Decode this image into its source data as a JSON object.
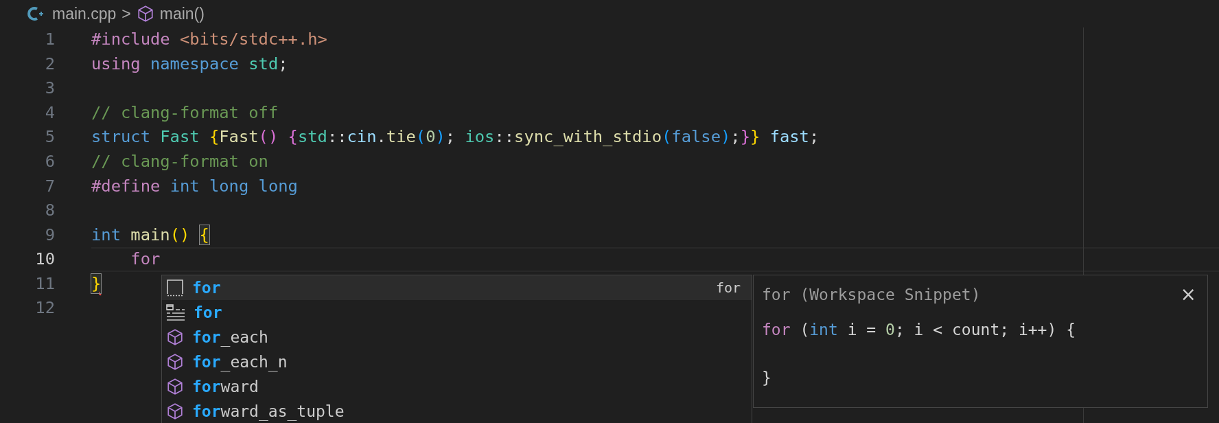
{
  "breadcrumb": {
    "file": "main.cpp",
    "separator": ">",
    "symbol": "main()"
  },
  "editor": {
    "lines": [
      {
        "number": "1",
        "active": false,
        "tokens": [
          {
            "text": "#include ",
            "kind": "keyword"
          },
          {
            "text": "<bits/stdc++.h>",
            "kind": "string"
          }
        ]
      },
      {
        "number": "2",
        "active": false,
        "tokens": [
          {
            "text": "using ",
            "kind": "keyword"
          },
          {
            "text": "namespace ",
            "kind": "storage"
          },
          {
            "text": "std",
            "kind": "type"
          },
          {
            "text": ";",
            "kind": "plain"
          }
        ]
      },
      {
        "number": "3",
        "active": false
      },
      {
        "number": "4",
        "active": false,
        "tokens": [
          {
            "text": "// clang-format off",
            "kind": "comment"
          }
        ]
      },
      {
        "number": "5",
        "active": false,
        "tokens": [
          {
            "text": "struct ",
            "kind": "storage"
          },
          {
            "text": "Fast ",
            "kind": "type"
          },
          {
            "text": "{",
            "kind": "bracket1"
          },
          {
            "text": "Fast",
            "kind": "func"
          },
          {
            "text": "() ",
            "kind": "bracket2"
          },
          {
            "text": "{",
            "kind": "bracket2"
          },
          {
            "text": "std",
            "kind": "type"
          },
          {
            "text": "::",
            "kind": "plain"
          },
          {
            "text": "cin",
            "kind": "variable"
          },
          {
            "text": ".",
            "kind": "plain"
          },
          {
            "text": "tie",
            "kind": "func"
          },
          {
            "text": "(",
            "kind": "bracket3"
          },
          {
            "text": "0",
            "kind": "number"
          },
          {
            "text": ")",
            "kind": "bracket3"
          },
          {
            "text": "; ",
            "kind": "plain"
          },
          {
            "text": "ios",
            "kind": "type"
          },
          {
            "text": "::",
            "kind": "plain"
          },
          {
            "text": "sync_with_stdio",
            "kind": "func"
          },
          {
            "text": "(",
            "kind": "bracket3"
          },
          {
            "text": "false",
            "kind": "storage"
          },
          {
            "text": ")",
            "kind": "bracket3"
          },
          {
            "text": ";",
            "kind": "plain"
          },
          {
            "text": "}",
            "kind": "bracket2"
          },
          {
            "text": "} ",
            "kind": "bracket1"
          },
          {
            "text": "fast",
            "kind": "variable"
          },
          {
            "text": ";",
            "kind": "plain"
          }
        ]
      },
      {
        "number": "6",
        "active": false,
        "tokens": [
          {
            "text": "// clang-format on",
            "kind": "comment"
          }
        ]
      },
      {
        "number": "7",
        "active": false,
        "tokens": [
          {
            "text": "#define ",
            "kind": "keyword"
          },
          {
            "text": "int ",
            "kind": "storage"
          },
          {
            "text": "long long",
            "kind": "storage"
          }
        ]
      },
      {
        "number": "8",
        "active": false
      },
      {
        "number": "9",
        "active": false,
        "tokens": [
          {
            "text": "int ",
            "kind": "storage"
          },
          {
            "text": "main",
            "kind": "func"
          },
          {
            "text": "() ",
            "kind": "bracket1"
          },
          {
            "text": "{",
            "kind": "bracket1",
            "matched": true
          }
        ]
      },
      {
        "number": "10",
        "active": true,
        "tokens": [
          {
            "text": "    for",
            "kind": "keyword"
          }
        ]
      },
      {
        "number": "11",
        "active": false,
        "tokens": [
          {
            "text": "}",
            "kind": "bracket1",
            "matched": true,
            "error": true
          }
        ]
      },
      {
        "number": "12",
        "active": false
      }
    ]
  },
  "suggestions": [
    {
      "kind": "snippet",
      "match": "for",
      "detail": "for",
      "selected": true
    },
    {
      "kind": "keyword",
      "match": "for",
      "selected": false
    },
    {
      "kind": "symbol",
      "match": "for",
      "rest": "_each",
      "selected": false
    },
    {
      "kind": "symbol",
      "match": "for",
      "rest": "_each_n",
      "selected": false
    },
    {
      "kind": "symbol",
      "match": "for",
      "rest": "ward",
      "selected": false
    },
    {
      "kind": "symbol",
      "match": "for",
      "rest": "ward_as_tuple",
      "selected": false
    }
  ],
  "details": {
    "title": "for (Workspace Snippet)",
    "close": "×",
    "code": [
      {
        "tokens": [
          {
            "text": "for",
            "kind": "keyword"
          },
          {
            "text": " (",
            "kind": "plain"
          },
          {
            "text": "int",
            "kind": "storage"
          },
          {
            "text": " i = ",
            "kind": "plain"
          },
          {
            "text": "0",
            "kind": "number"
          },
          {
            "text": "; i < count; i++) {",
            "kind": "plain"
          }
        ]
      },
      {
        "tokens": [
          {
            "text": "}",
            "kind": "plain"
          }
        ]
      }
    ]
  }
}
